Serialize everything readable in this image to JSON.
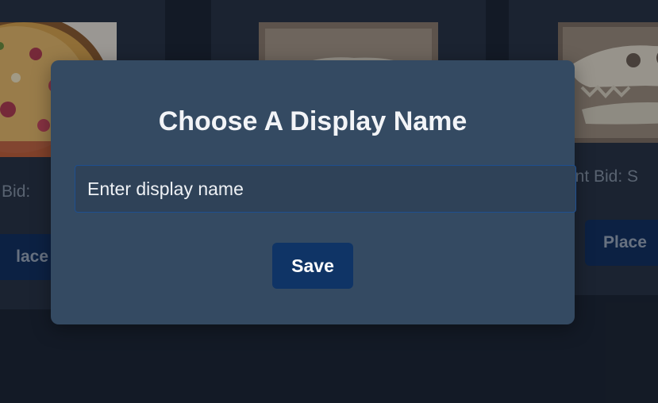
{
  "modal": {
    "title": "Choose A Display Name",
    "input": {
      "placeholder": "Enter display name",
      "value": ""
    },
    "save_label": "Save"
  },
  "background": {
    "cards": [
      {
        "image": "pizza-image",
        "bid_text": "rent Bid:",
        "button_label": "lace B"
      },
      {
        "image": "dinosaur-skull-image"
      },
      {
        "image": "dinosaur-skull-image",
        "bid_text": "rrent Bid: S",
        "button_label": "Place"
      }
    ]
  },
  "colors": {
    "page_bg": "#1a2330",
    "card_bg": "#253141",
    "modal_bg": "#344a62",
    "button_bg": "#0f3466",
    "input_border": "#1e4f8f"
  }
}
